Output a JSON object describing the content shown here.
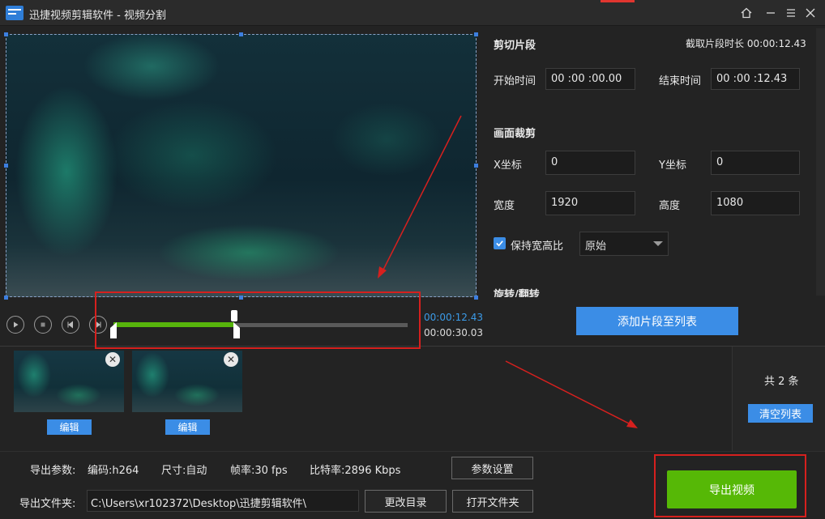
{
  "window": {
    "title": "迅捷视频剪辑软件 - 视频分割",
    "accent_color": "#e0352f",
    "buttons": [
      "home-icon",
      "minimize-icon",
      "menu-icon",
      "close-icon"
    ]
  },
  "player": {
    "current_time": "00:00:12.43",
    "total_time": "00:00:30.03",
    "trim_progress": 0.41,
    "controls": [
      "play-icon",
      "stop-icon",
      "prev-frame-icon",
      "next-frame-icon"
    ]
  },
  "clip": {
    "section_title": "剪切片段",
    "duration_label": "截取片段时长 00:00:12.43",
    "start_label": "开始时间",
    "start_value": "00 :00 :00.00",
    "end_label": "结束时间",
    "end_value": "00 :00 :12.43"
  },
  "crop": {
    "section_title": "画面裁剪",
    "x_label": "X坐标",
    "x_value": "0",
    "y_label": "Y坐标",
    "y_value": "0",
    "width_label": "宽度",
    "width_value": "1920",
    "height_label": "高度",
    "height_value": "1080",
    "keep_ratio_label": "保持宽高比",
    "keep_ratio_checked": true,
    "ratio_option": "原始"
  },
  "rotate": {
    "section_title": "旋转/翻转"
  },
  "add_button": "添加片段至列表",
  "list": {
    "items": [
      {
        "edit_label": "编辑"
      },
      {
        "edit_label": "编辑"
      }
    ],
    "count_label": "共 2 条",
    "clear_button": "清空列表"
  },
  "export": {
    "params_label": "导出参数:",
    "codec": "编码:h264",
    "size": "尺寸:自动",
    "framerate": "帧率:30 fps",
    "bitrate": "比特率:2896 Kbps",
    "settings_button": "参数设置",
    "folder_label": "导出文件夹:",
    "folder_path": "C:\\Users\\xr102372\\Desktop\\迅捷剪辑软件\\",
    "change_dir_button": "更改目录",
    "open_folder_button": "打开文件夹",
    "export_button": "导出视频",
    "export_color": "#56b806"
  },
  "annotation_color": "#d6201e"
}
